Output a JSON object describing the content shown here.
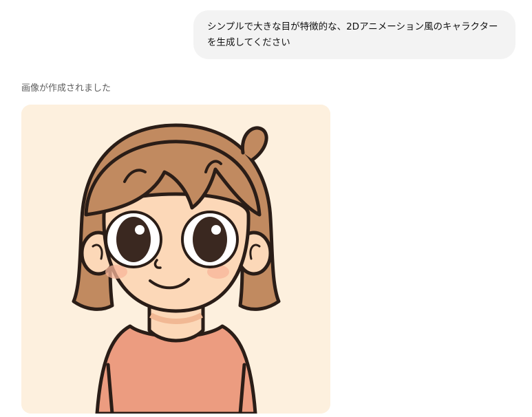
{
  "conversation": {
    "user_message": "シンプルで大きな目が特徴的な、2Dアニメーション風のキャラクターを生成してください",
    "assistant_status": "画像が作成されました"
  },
  "generated_image": {
    "background_color": "#fdf0de",
    "hair_color": "#c18a60",
    "skin_color": "#fcd8b8",
    "shirt_color": "#ec9c80",
    "outline_color": "#2a1d17"
  }
}
